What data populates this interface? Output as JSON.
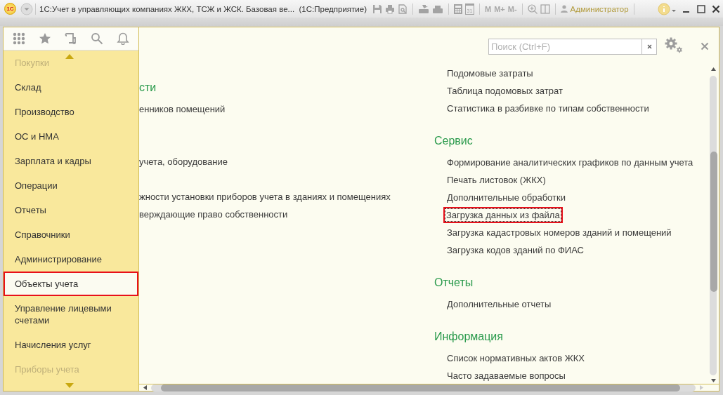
{
  "window": {
    "logo": "1С",
    "title": "1С:Учет в управляющих компаниях ЖКХ, ТСЖ и ЖСК. Базовая ве...  (1С:Предприятие)",
    "calendar_day": "31",
    "memory_buttons": [
      "M",
      "M+",
      "M-"
    ],
    "user": "Администратор"
  },
  "sidebar": {
    "items": [
      {
        "label": "Покупки",
        "faded": true,
        "selected": false
      },
      {
        "label": "Склад",
        "faded": false,
        "selected": false
      },
      {
        "label": "Производство",
        "faded": false,
        "selected": false
      },
      {
        "label": "ОС и НМА",
        "faded": false,
        "selected": false
      },
      {
        "label": "Зарплата и кадры",
        "faded": false,
        "selected": false
      },
      {
        "label": "Операции",
        "faded": false,
        "selected": false
      },
      {
        "label": "Отчеты",
        "faded": false,
        "selected": false
      },
      {
        "label": "Справочники",
        "faded": false,
        "selected": false
      },
      {
        "label": "Администрирование",
        "faded": false,
        "selected": false
      },
      {
        "label": "Объекты учета",
        "faded": false,
        "selected": true
      },
      {
        "label": "Управление лицевыми счетами",
        "faded": false,
        "selected": false
      },
      {
        "label": "Начисления услуг",
        "faded": false,
        "selected": false
      },
      {
        "label": "Приборы учета",
        "faded": true,
        "selected": false
      }
    ]
  },
  "content": {
    "search": {
      "placeholder": "Поиск (Ctrl+F)"
    },
    "left_column": [
      {
        "kind": "heading",
        "text": "сти"
      },
      {
        "kind": "link",
        "text": "енников помещений",
        "focused": false
      },
      {
        "kind": "link",
        "text": "учета, оборудование",
        "focused": false
      },
      {
        "kind": "link",
        "text": "жности установки приборов учета в зданиях и помещениях",
        "focused": false
      },
      {
        "kind": "link",
        "text": "верждающие право собственности",
        "focused": false
      }
    ],
    "right_column": [
      {
        "kind": "link",
        "text": "Подомовые затраты",
        "focused": false
      },
      {
        "kind": "link",
        "text": "Таблица подомовых затрат",
        "focused": false
      },
      {
        "kind": "link",
        "text": "Статистика в разбивке по типам собственности",
        "focused": false
      },
      {
        "kind": "heading",
        "text": "Сервис"
      },
      {
        "kind": "link",
        "text": "Формирование аналитических графиков по данным учета",
        "focused": false
      },
      {
        "kind": "link",
        "text": "Печать листовок (ЖКХ)",
        "focused": false
      },
      {
        "kind": "link",
        "text": "Дополнительные обработки",
        "focused": false
      },
      {
        "kind": "link",
        "text": "Загрузка данных из файла",
        "focused": true
      },
      {
        "kind": "link",
        "text": "Загрузка кадастровых номеров зданий и помещений",
        "focused": false
      },
      {
        "kind": "link",
        "text": "Загрузка кодов зданий по ФИАС",
        "focused": false
      },
      {
        "kind": "heading",
        "text": "Отчеты"
      },
      {
        "kind": "link",
        "text": "Дополнительные отчеты",
        "focused": false
      },
      {
        "kind": "heading",
        "text": "Информация"
      },
      {
        "kind": "link",
        "text": "Список нормативных актов ЖКХ",
        "focused": false
      },
      {
        "kind": "link",
        "text": "Часто задаваемые вопросы",
        "focused": false
      }
    ]
  }
}
